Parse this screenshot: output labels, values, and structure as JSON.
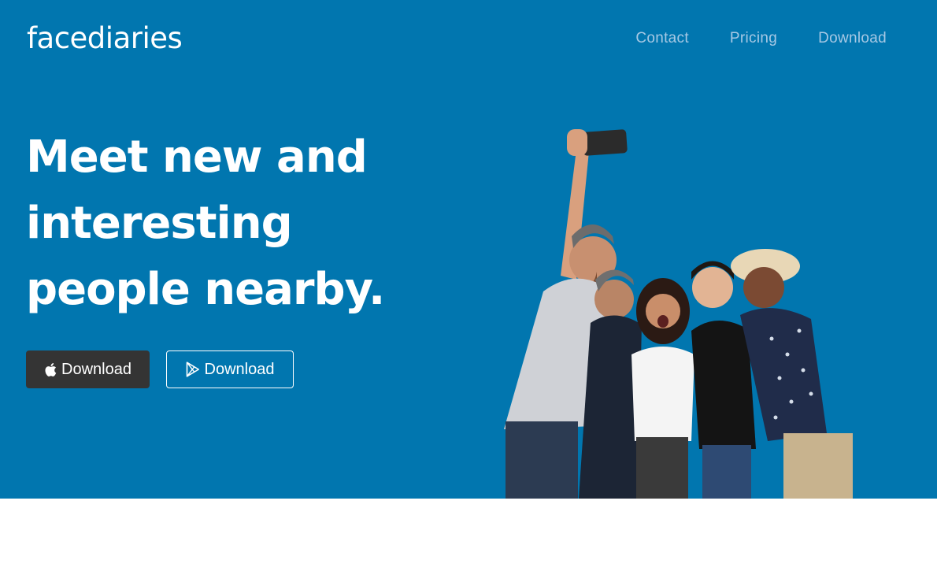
{
  "brand": {
    "logo_text": "facediaries"
  },
  "nav": {
    "items": [
      {
        "label": "Contact"
      },
      {
        "label": "Pricing"
      },
      {
        "label": "Download"
      }
    ],
    "color": "#a6c8e4"
  },
  "hero": {
    "headline_lines": [
      "Meet new and",
      "interesting",
      "people nearby."
    ],
    "background_color": "#0176af",
    "buttons": [
      {
        "label": "Download",
        "icon": "apple-icon",
        "style": "filled",
        "color": "#343434"
      },
      {
        "label": "Download",
        "icon": "google-play-icon",
        "style": "outline"
      }
    ],
    "image": {
      "description_icon": "group-selfie-photo"
    }
  }
}
